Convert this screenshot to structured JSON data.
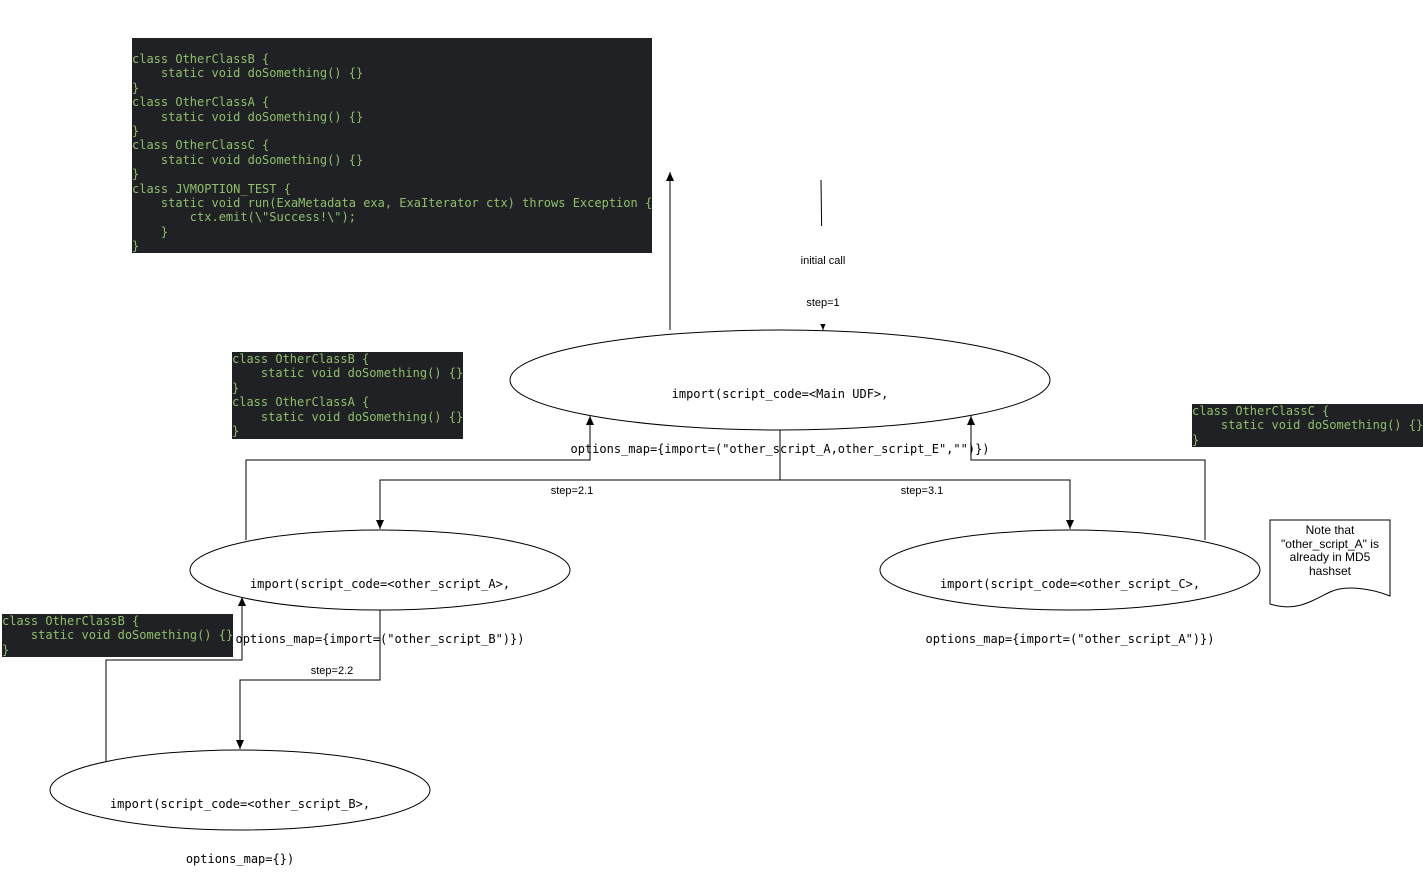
{
  "code_blocks": {
    "top": "class OtherClassB {\n    static void doSomething() {}\n}\nclass OtherClassA {\n    static void doSomething() {}\n}\nclass OtherClassC {\n    static void doSomething() {}\n}\nclass JVMOPTION_TEST {\n    static void run(ExaMetadata exa, ExaIterator ctx) throws Exception {\n        ctx.emit(\\\"Success!\\\");\n    }\n}",
    "middle": "class OtherClassB {\n    static void doSomething() {}\n}\nclass OtherClassA {\n    static void doSomething() {}\n}",
    "right": "class OtherClassC {\n    static void doSomething() {}\n}",
    "left": "class OtherClassB {\n    static void doSomething() {}\n}"
  },
  "nodes": {
    "main": {
      "line1": "import(script_code=<Main UDF>,",
      "line2": "options_map={import=(\"other_script_A,other_script_E\",\"\")})"
    },
    "script_a": {
      "line1": "import(script_code=<other_script_A>,",
      "line2": "options_map={import=(\"other_script_B\")})"
    },
    "script_c": {
      "line1": "import(script_code=<other_script_C>,",
      "line2": "options_map={import=(\"other_script_A\")})"
    },
    "script_b": {
      "line1": "import(script_code=<other_script_B>,",
      "line2": "options_map={})"
    }
  },
  "edge_labels": {
    "initial_call": "initial call",
    "step_1": "step=1",
    "step_2_1": "step=2.1",
    "step_3_1": "step=3.1",
    "step_2_2": "step=2.2"
  },
  "note": {
    "text": "Note that \"other_script_A\" is already in MD5 hashset"
  },
  "colors": {
    "code_bg": "#1f2124",
    "code_text": "#8fbf6a",
    "stroke": "#000000"
  }
}
